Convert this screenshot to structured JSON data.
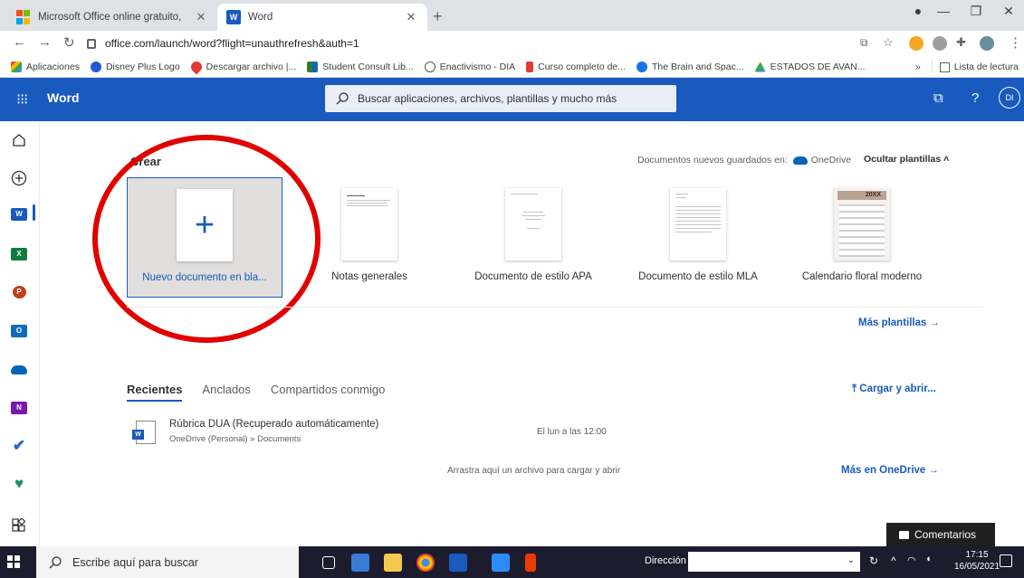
{
  "browser": {
    "tabs": [
      {
        "title": "Microsoft Office online gratuito, ",
        "active": false
      },
      {
        "title": "Word",
        "active": true
      }
    ],
    "url": "office.com/launch/word?flight=unauthrefresh&auth=1",
    "bookmarks": [
      "Aplicaciones",
      "Disney Plus Logo",
      "Descargar archivo |...",
      "Student Consult Lib...",
      "Enactivismo - DIA",
      "Curso completo de...",
      "The Brain and Spac...",
      "ESTADOS DE AVAN..."
    ],
    "bookmarks_overflow": "»",
    "reading_list": "Lista de lectura"
  },
  "appbar": {
    "app_name": "Word",
    "search_placeholder": "Buscar aplicaciones, archivos, plantillas y mucho más",
    "avatar_initials": "DI",
    "help": "?"
  },
  "create": {
    "label": "Crear",
    "saved_note": "Documentos nuevos guardados en:",
    "saved_location": "OneDrive",
    "hide_templates": "Ocultar plantillas",
    "templates": [
      "Nuevo documento en bla...",
      "Notas generales",
      "Documento de estilo APA",
      "Documento de estilo MLA",
      "Calendario floral moderno"
    ],
    "calendar_thumb_text": "20XX",
    "more_templates": "Más plantillas"
  },
  "files": {
    "tabs": [
      "Recientes",
      "Anclados",
      "Compartidos conmigo"
    ],
    "upload": "Cargar y abrir...",
    "recent": [
      {
        "name": "Rúbrica DUA (Recuperado automáticamente)",
        "path": "OneDrive (Personal) » Documents",
        "date": "El lun a las 12:00"
      }
    ],
    "drop_hint": "Arrastra aquí un archivo para cargar y abrir",
    "more_onedrive": "Más en OneDrive"
  },
  "feedback": "Comentarios",
  "taskbar": {
    "search_placeholder": "Escribe aquí para buscar",
    "address_label": "Dirección",
    "time": "17:15",
    "date": "16/05/2021"
  },
  "colors": {
    "word_blue": "#185abd",
    "highlight_red": "#e00000"
  }
}
